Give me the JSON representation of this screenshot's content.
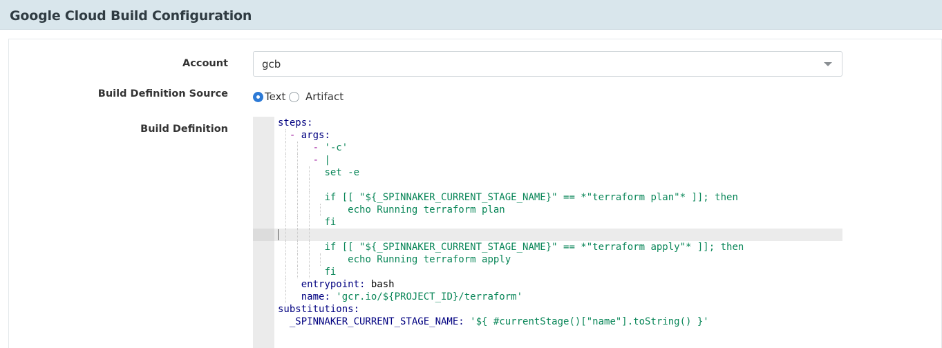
{
  "header": {
    "title": "Google Cloud Build Configuration"
  },
  "form": {
    "account": {
      "label": "Account",
      "value": "gcb"
    },
    "source": {
      "label": "Build Definition Source",
      "options": [
        {
          "label": "Text",
          "checked": true
        },
        {
          "label": "Artifact",
          "checked": false
        }
      ]
    },
    "definition": {
      "label": "Build Definition",
      "lines": [
        "steps:",
        "  - args:",
        "      - '-c'",
        "      - |",
        "        set -e",
        "",
        "        if [[ \"${_SPINNAKER_CURRENT_STAGE_NAME}\" == *\"terraform plan\"* ]]; then",
        "            echo Running terraform plan",
        "        fi",
        "",
        "        if [[ \"${_SPINNAKER_CURRENT_STAGE_NAME}\" == *\"terraform apply\"* ]]; then",
        "            echo Running terraform apply",
        "        fi",
        "    entrypoint: bash",
        "    name: 'gcr.io/${PROJECT_ID}/terraform'",
        "substitutions:",
        "  _SPINNAKER_CURRENT_STAGE_NAME: '${ #currentStage()[\"name\"].toString() }'"
      ]
    }
  },
  "colors": {
    "header_bg": "#d9e6ec",
    "radio_checked": "#2d7ad6",
    "yaml_key": "#000080",
    "yaml_string": "#098658",
    "yaml_dash": "#a020a0"
  }
}
